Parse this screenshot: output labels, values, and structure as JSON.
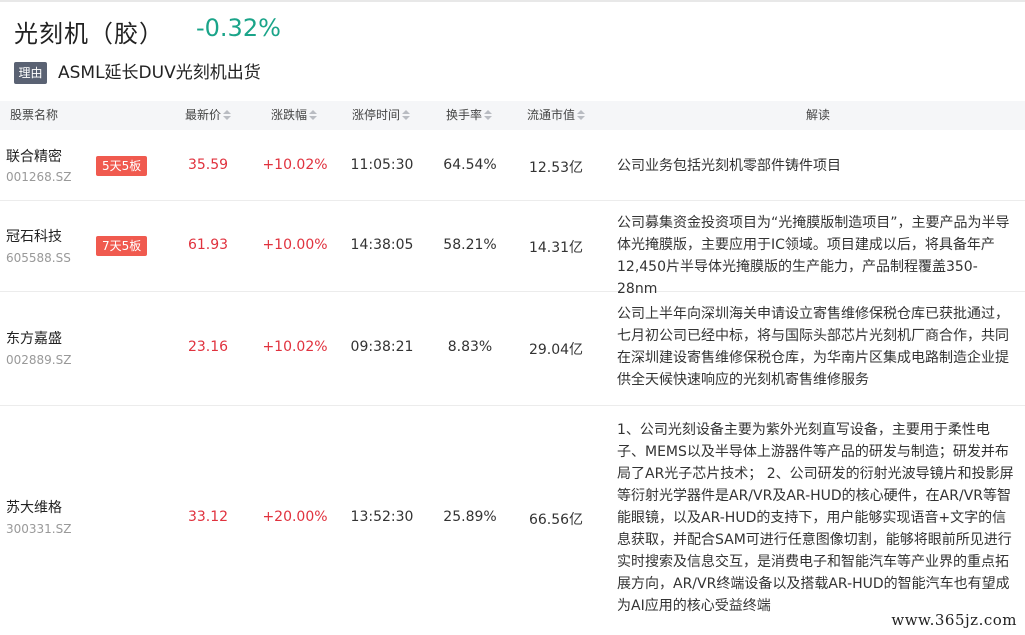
{
  "header": {
    "title": "光刻机（胶）",
    "change": "-0.32%",
    "reason_tag": "理由",
    "reason_text": "ASML延长DUV光刻机出货"
  },
  "table": {
    "columns": {
      "name": "股票名称",
      "price": "最新价",
      "change": "涨跌幅",
      "limit_time": "涨停时间",
      "turnover": "换手率",
      "float_cap": "流通市值",
      "desc": "解读"
    },
    "rows": [
      {
        "name": "联合精密",
        "code": "001268.SZ",
        "badge": "5天5板",
        "price": "35.59",
        "change": "+10.02%",
        "time": "11:05:30",
        "turnover": "64.54%",
        "cap": "12.53亿",
        "desc": "公司业务包括光刻机零部件铸件项目"
      },
      {
        "name": "冠石科技",
        "code": "605588.SS",
        "badge": "7天5板",
        "price": "61.93",
        "change": "+10.00%",
        "time": "14:38:05",
        "turnover": "58.21%",
        "cap": "14.31亿",
        "desc": "公司募集资金投资项目为“光掩膜版制造项目”，主要产品为半导体光掩膜版，主要应用于IC领域。项目建成以后，将具备年产12,450片半导体光掩膜版的生产能力，产品制程覆盖350-28nm"
      },
      {
        "name": "东方嘉盛",
        "code": "002889.SZ",
        "badge": "",
        "price": "23.16",
        "change": "+10.02%",
        "time": "09:38:21",
        "turnover": "8.83%",
        "cap": "29.04亿",
        "desc": "公司上半年向深圳海关申请设立寄售维修保税仓库已获批通过，七月初公司已经中标，将与国际头部芯片光刻机厂商合作，共同在深圳建设寄售维修保税仓库，为华南片区集成电路制造企业提供全天候快速响应的光刻机寄售维修服务"
      },
      {
        "name": "苏大维格",
        "code": "300331.SZ",
        "badge": "",
        "price": "33.12",
        "change": "+20.00%",
        "time": "13:52:30",
        "turnover": "25.89%",
        "cap": "66.56亿",
        "desc": "1、公司光刻设备主要为紫外光刻直写设备，主要用于柔性电子、MEMS以及半导体上游器件等产品的研发与制造；研发并布局了AR光子芯片技术； 2、公司研发的衍射光波导镜片和投影屏等衍射光学器件是AR/VR及AR-HUD的核心硬件，在AR/VR等智能眼镜，以及AR-HUD的支持下，用户能够实现语音+文字的信息获取，并配合SAM可进行任意图像切割，能够将眼前所见进行实时搜索及信息交互，是消费电子和智能汽车等产业界的重点拓展方向，AR/VR终端设备以及搭载AR-HUD的智能汽车也有望成为AI应用的核心受益终端"
      }
    ]
  },
  "watermark": "www.365jz.com"
}
